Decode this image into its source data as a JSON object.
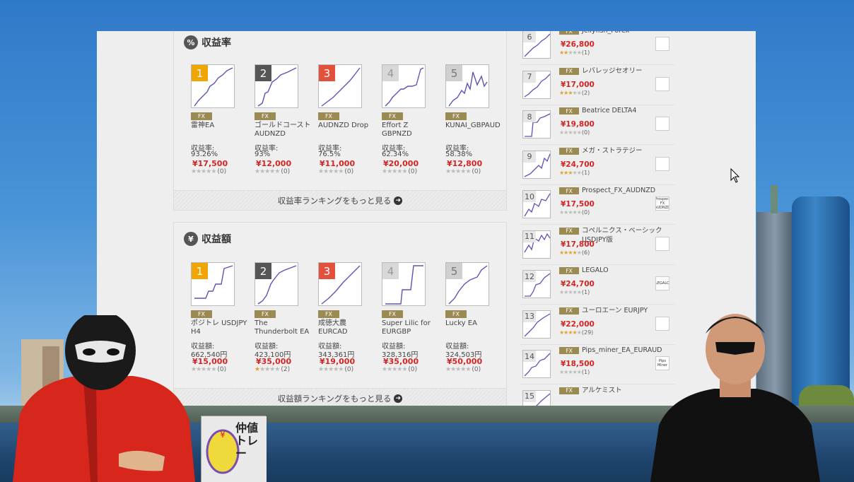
{
  "sections": {
    "return_rate": {
      "icon": "%",
      "title": "収益率",
      "metric_label": "収益率:",
      "more_label": "収益率ランキングをもっと見る",
      "items": [
        {
          "rank": "1",
          "tag": "FX",
          "name": "雷神EA",
          "metric": "93.26%",
          "price": "¥17,500",
          "stars": 0,
          "reviews": "(0)"
        },
        {
          "rank": "2",
          "tag": "FX",
          "name": "ゴールドコースト AUDNZD",
          "metric": "93%",
          "price": "¥12,000",
          "stars": 0,
          "reviews": "(0)"
        },
        {
          "rank": "3",
          "tag": "FX",
          "name": "AUDNZD Drop",
          "metric": "76.5%",
          "price": "¥11,000",
          "stars": 0,
          "reviews": "(0)"
        },
        {
          "rank": "4",
          "tag": "FX",
          "name": "Effort Z GBPNZD",
          "metric": "62.34%",
          "price": "¥20,000",
          "stars": 0,
          "reviews": "(0)"
        },
        {
          "rank": "5",
          "tag": "FX",
          "name": "KUNAI_GBPAUD",
          "metric": "58.38%",
          "price": "¥12,800",
          "stars": 0,
          "reviews": "(0)"
        }
      ]
    },
    "profit_amount": {
      "icon": "¥",
      "title": "収益額",
      "metric_label": "収益額:",
      "more_label": "収益額ランキングをもっと見る",
      "items": [
        {
          "rank": "1",
          "tag": "FX",
          "name": "ポジトレ USDJPY H4",
          "metric": "662,540円",
          "price": "¥15,000",
          "stars": 0,
          "reviews": "(0)"
        },
        {
          "rank": "2",
          "tag": "FX",
          "name": "The Thunderbolt EA",
          "metric": "423,100円",
          "price": "¥35,000",
          "stars": 1,
          "reviews": "(2)"
        },
        {
          "rank": "3",
          "tag": "FX",
          "name": "成徳大農 EURCAD",
          "metric": "343,361円",
          "price": "¥19,000",
          "stars": 0,
          "reviews": "(0)"
        },
        {
          "rank": "4",
          "tag": "FX",
          "name": "Super Lilic for EURGBP",
          "metric": "328,316円",
          "price": "¥35,000",
          "stars": 0,
          "reviews": "(0)"
        },
        {
          "rank": "5",
          "tag": "FX",
          "name": "Lucky EA",
          "metric": "324,503円",
          "price": "¥50,000",
          "stars": 0,
          "reviews": "(0)"
        }
      ]
    }
  },
  "ranking_list": [
    {
      "rank": "6",
      "tag": "FX",
      "name": "Jellyfish_Forex",
      "price": "¥26,800",
      "stars": 2,
      "reviews": "(1)",
      "logo": ""
    },
    {
      "rank": "7",
      "tag": "FX",
      "name": "レバレッジセオリー",
      "price": "¥17,000",
      "stars": 3,
      "reviews": "(2)",
      "logo": ""
    },
    {
      "rank": "8",
      "tag": "FX",
      "name": "Beatrice DELTA4",
      "price": "¥19,800",
      "stars": 0,
      "reviews": "(0)",
      "logo": ""
    },
    {
      "rank": "9",
      "tag": "FX",
      "name": "メガ・ストラテジー",
      "price": "¥24,700",
      "stars": 3,
      "reviews": "(1)",
      "logo": ""
    },
    {
      "rank": "10",
      "tag": "FX",
      "name": "Prospect_FX_AUDNZD",
      "price": "¥17,500",
      "stars": 0,
      "reviews": "(0)",
      "logo": "Prospect FX AUDNZD"
    },
    {
      "rank": "11",
      "tag": "FX",
      "name": "コペルニクス・ベーシックUSDJPY版",
      "price": "¥17,800",
      "stars": 4,
      "reviews": "(6)",
      "logo": ""
    },
    {
      "rank": "12",
      "tag": "FX",
      "name": "LEGALO",
      "price": "¥24,700",
      "stars": 0,
      "reviews": "(1)",
      "logo": "LEGALO"
    },
    {
      "rank": "13",
      "tag": "FX",
      "name": "ユーロエーン EURJPY",
      "price": "¥22,000",
      "stars": 4,
      "reviews": "(29)",
      "logo": ""
    },
    {
      "rank": "14",
      "tag": "FX",
      "name": "Pips_miner_EA_EURAUD",
      "price": "¥18,500",
      "stars": 0,
      "reviews": "(1)",
      "logo": "Pips Miner"
    },
    {
      "rank": "15",
      "tag": "FX",
      "name": "アルケミスト",
      "price": "",
      "stars": 0,
      "reviews": "",
      "logo": ""
    }
  ],
  "book": {
    "title": "仲値トレー"
  },
  "colors": {
    "rank1": "#f0a500",
    "rank2": "#555555",
    "rank3": "#e2513c",
    "rank4": "#d8d8d8",
    "rank5": "#cfcfcf",
    "price": "#d72323",
    "fx_tag": "#9b8a52"
  }
}
